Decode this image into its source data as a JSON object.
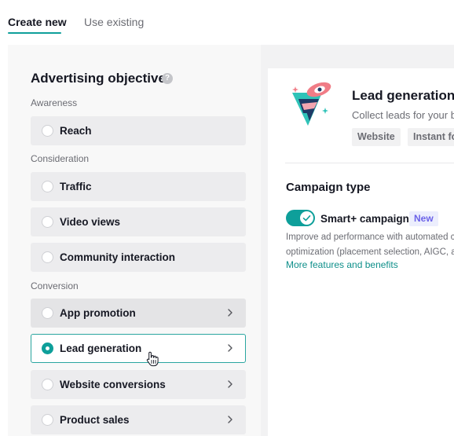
{
  "tabs": [
    {
      "label": "Create new",
      "active": true
    },
    {
      "label": "Use existing",
      "active": false
    }
  ],
  "objective": {
    "title": "Advertising objective",
    "help_icon": "question-circle-icon"
  },
  "sections": {
    "awareness": "Awareness",
    "consideration": "Consideration",
    "conversion": "Conversion"
  },
  "options": {
    "reach": "Reach",
    "traffic": "Traffic",
    "video_views": "Video views",
    "community_interaction": "Community interaction",
    "app_promotion": "App promotion",
    "lead_generation": "Lead generation",
    "website_conversions": "Website conversions",
    "product_sales": "Product sales"
  },
  "selected_option": "Lead generation",
  "detail": {
    "title": "Lead generation",
    "description": "Collect leads for your b",
    "chips": [
      "Website",
      "Instant fo"
    ],
    "illustration": "lead-generation-illustration"
  },
  "campaign_type": {
    "title": "Campaign type",
    "toggle_on": true,
    "smart_label": "Smart+ campaign",
    "badge": "New",
    "desc_line1": "Improve ad performance with automated c",
    "desc_line2": "optimization (placement selection, AIGC, a",
    "more_link": "More features and benefits"
  },
  "colors": {
    "accent": "#0e9f9a",
    "new_badge_text": "#6b62e8",
    "new_badge_bg": "#eceefd"
  }
}
